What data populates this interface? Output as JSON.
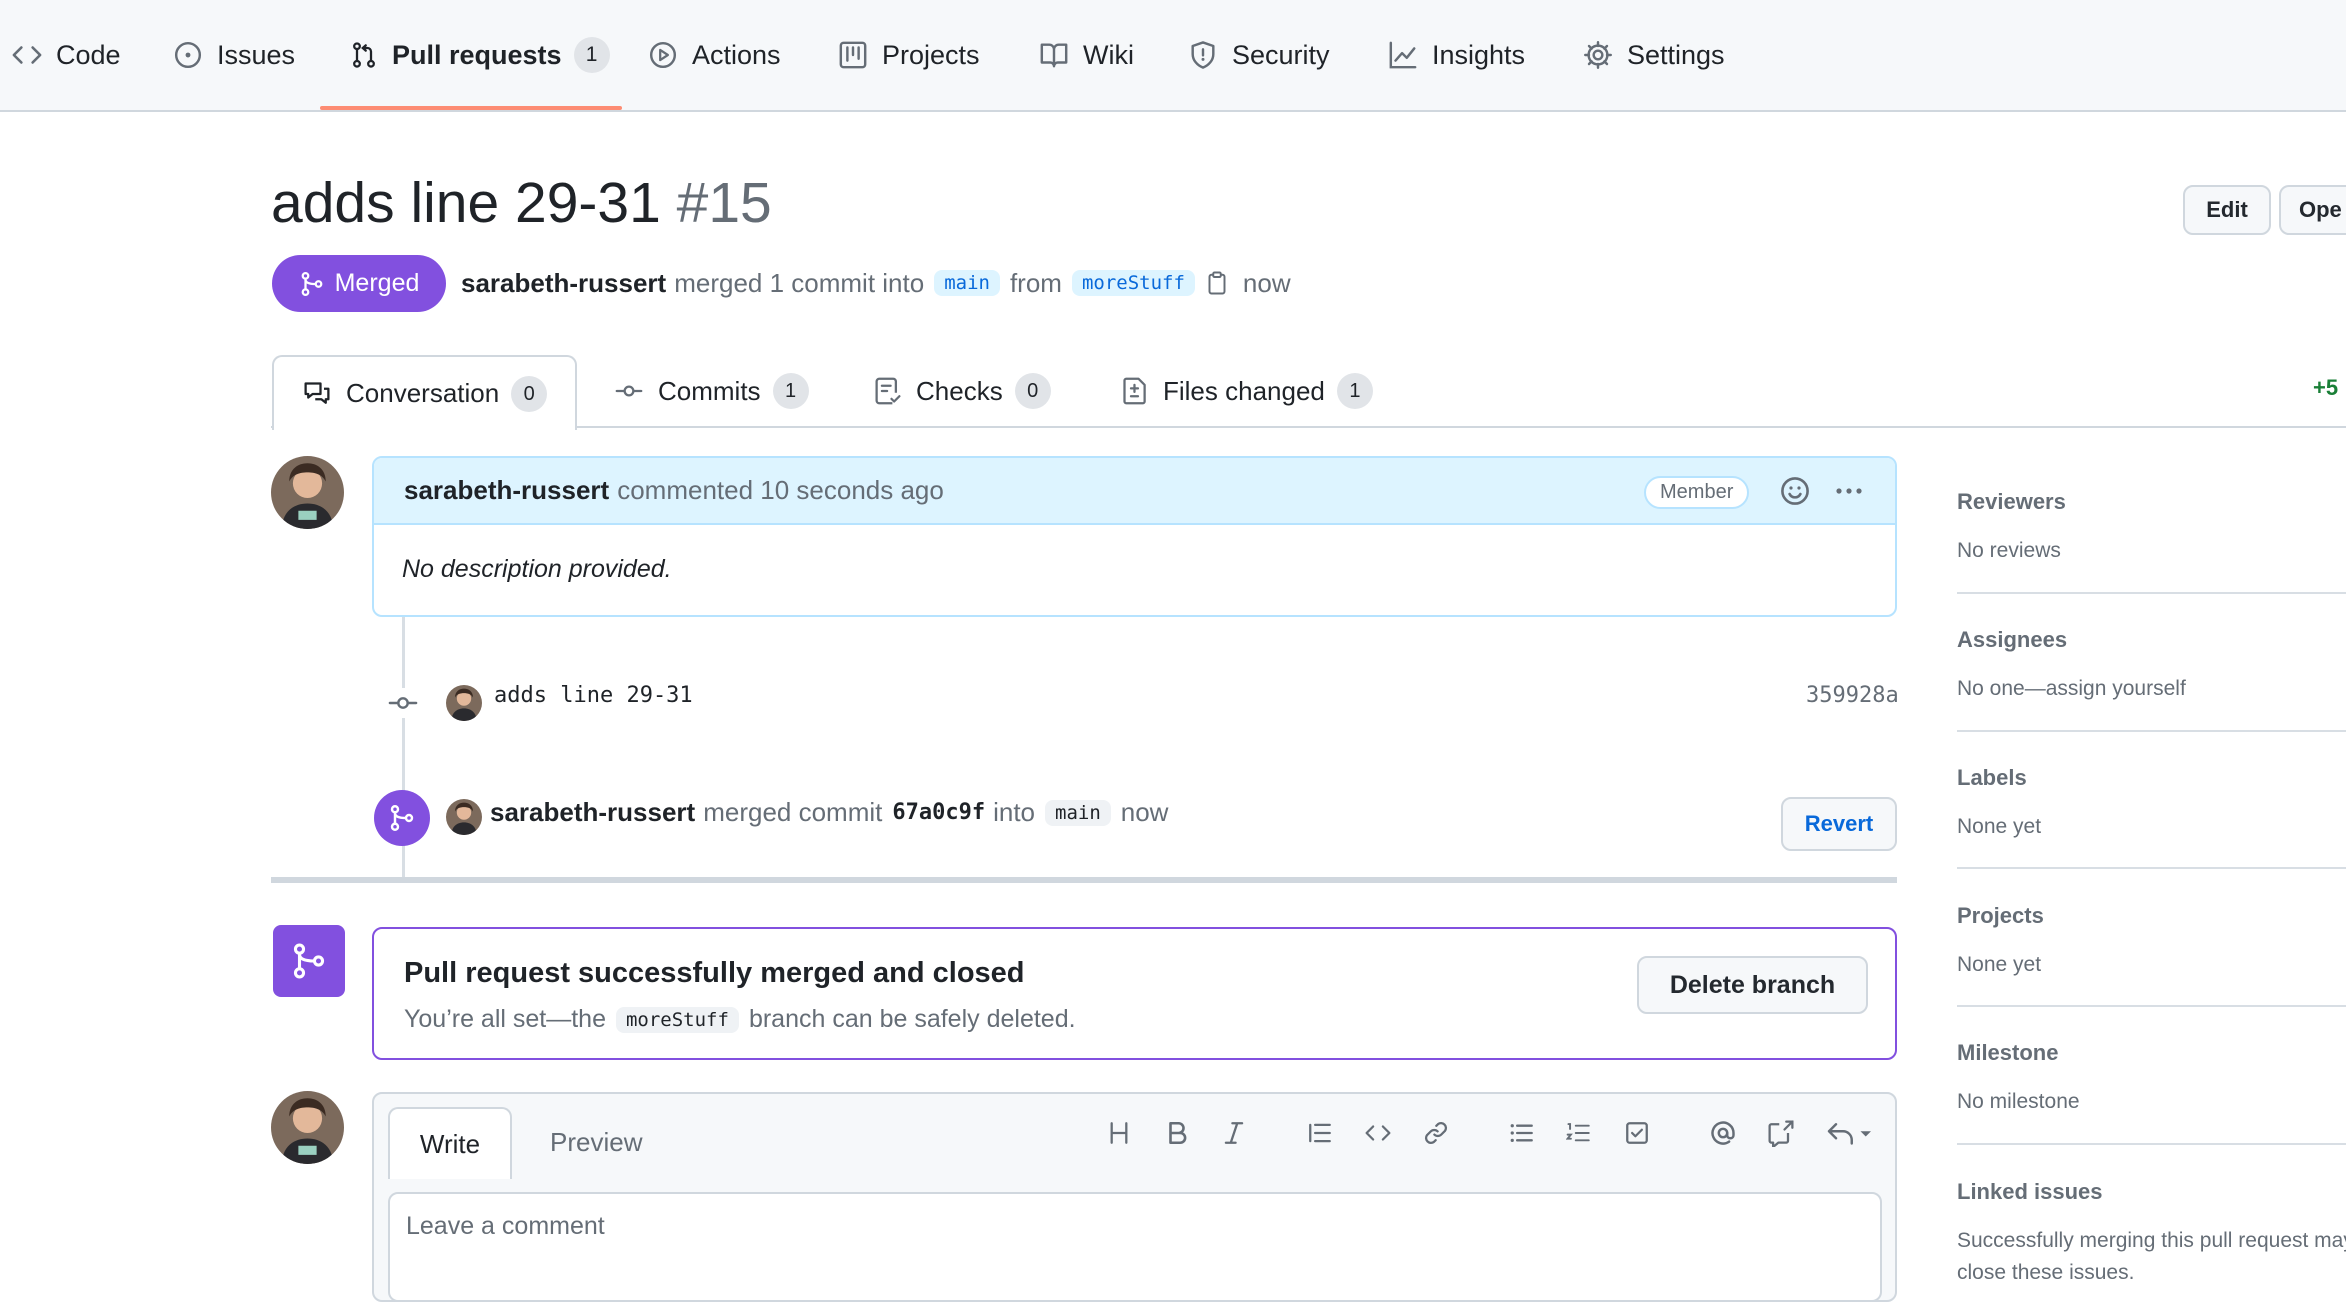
{
  "nav": {
    "code": "Code",
    "issues": "Issues",
    "pull_requests": "Pull requests",
    "pull_requests_count": "1",
    "actions": "Actions",
    "projects": "Projects",
    "wiki": "Wiki",
    "security": "Security",
    "insights": "Insights",
    "settings": "Settings"
  },
  "pr": {
    "title": "adds line 29-31",
    "number": "#15",
    "state": "Merged",
    "author": "sarabeth-russert",
    "summary_text": "merged 1 commit into",
    "base_branch": "main",
    "from_text": "from",
    "head_branch": "moreStuff",
    "time": "now"
  },
  "header_buttons": {
    "edit": "Edit",
    "open": "Ope"
  },
  "tabs": [
    {
      "label": "Conversation",
      "count": "0"
    },
    {
      "label": "Commits",
      "count": "1"
    },
    {
      "label": "Checks",
      "count": "0"
    },
    {
      "label": "Files changed",
      "count": "1"
    }
  ],
  "diffstat": "+5",
  "comment": {
    "author": "sarabeth-russert",
    "action": "commented 10 seconds ago",
    "badge": "Member",
    "body": "No description provided."
  },
  "commit": {
    "message": "adds line 29-31",
    "sha": "359928a"
  },
  "merge_event": {
    "author": "sarabeth-russert",
    "text": "merged commit",
    "commit": "67a0c9f",
    "into": "into",
    "branch": "main",
    "time": "now",
    "revert_label": "Revert"
  },
  "merged_box": {
    "title": "Pull request successfully merged and closed",
    "sub_before": "You’re all set—the",
    "branch": "moreStuff",
    "sub_after": "branch can be safely deleted.",
    "delete_label": "Delete branch"
  },
  "comment_form": {
    "write_tab": "Write",
    "preview_tab": "Preview",
    "placeholder": "Leave a comment"
  },
  "sidebar": {
    "sections": [
      {
        "title": "Reviewers",
        "value": "No reviews"
      },
      {
        "title": "Assignees",
        "value": "No one—assign yourself"
      },
      {
        "title": "Labels",
        "value": "None yet"
      },
      {
        "title": "Projects",
        "value": "None yet"
      },
      {
        "title": "Milestone",
        "value": "No milestone"
      },
      {
        "title": "Linked issues",
        "value": "Successfully merging this pull request may close these issues."
      }
    ]
  },
  "colors": {
    "merged": "#8250df",
    "link": "#0969da",
    "nav_underline": "#fd8c73",
    "diff_add": "#1a7f37"
  }
}
